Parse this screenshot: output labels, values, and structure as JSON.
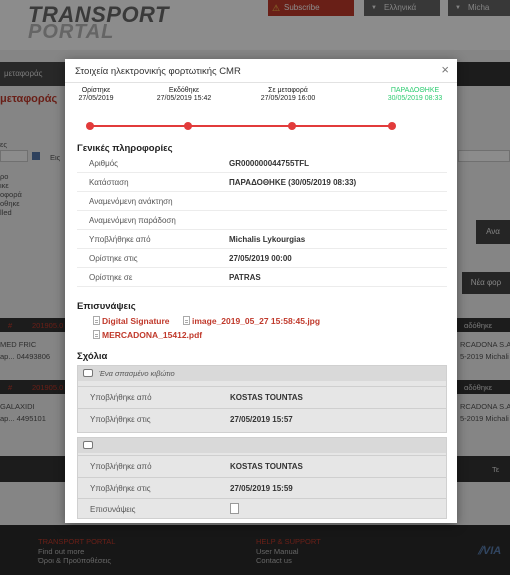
{
  "background": {
    "logo_line1": "TRANSPORT",
    "logo_line2": "PORTAL",
    "subscribe_label": "Subscribe",
    "language_label": "Ελληνικά",
    "user_label": "Micha",
    "nav_item": "μεταφοράς",
    "page_title": "μεταφοράς",
    "filter_lines": [
      "ες",
      "Εις",
      "ρο",
      "ικε",
      "οφορά",
      "οθηκε",
      "lled"
    ],
    "button_right": "Ανα",
    "button_new": "Νέα φορ",
    "row1": {
      "hash": "#",
      "id": "201905.0",
      "c1": "MED FRIC",
      "c2": "ap... 04493806",
      "d": "αδόθηκε",
      "e": "RCADONA S.A",
      "f": "5-2019 Michali"
    },
    "row2": {
      "hash": "#",
      "id": "201905.0",
      "c1": "GALAXIDI",
      "c2": "ap... 4495101",
      "d": "αδόθηκε",
      "e": "RCADONA S.A",
      "f": "5-2019 Michali"
    },
    "pager": "Τε",
    "footer": {
      "col1_title": "TRANSPORT PORTAL",
      "col1_link1": "Find out more",
      "col1_link2": "Όροι & Προϋποθέσεις",
      "col2_title": "HELP & SUPPORT",
      "col2_link1": "User Manual",
      "col2_link2": "Contact us",
      "brand": "VIA"
    }
  },
  "modal": {
    "title": "Στοιχεία ηλεκτρονικής φορτωτικής CMR",
    "close": "×",
    "timeline": [
      {
        "label": "Ορίστηκε",
        "date": "27/05/2019"
      },
      {
        "label": "Εκδόθηκε",
        "date": "27/05/2019 15:42"
      },
      {
        "label": "Σε μεταφορά",
        "date": "27/05/2019 16:00"
      },
      {
        "label": "ΠΑΡΑΔΟΘΗΚΕ",
        "date": "30/05/2019 08:33"
      }
    ],
    "general_title": "Γενικές πληροφορίες",
    "info": [
      {
        "label": "Αριθμός",
        "value": "GR000000044755TFL"
      },
      {
        "label": "Κατάσταση",
        "value": "ΠΑΡΑΔΟΘΗΚΕ (30/05/2019 08:33)"
      },
      {
        "label": "Αναμενόμενη ανάκτηση",
        "value": ""
      },
      {
        "label": "Αναμενόμενη παράδοση",
        "value": ""
      },
      {
        "label": "Υποβλήθηκε από",
        "value": "Michalis Lykourgias"
      },
      {
        "label": "Ορίστηκε στις",
        "value": "27/05/2019 00:00"
      },
      {
        "label": "Ορίστηκε σε",
        "value": "PATRAS"
      }
    ],
    "attachments_title": "Επισυνάψεις",
    "attachments": [
      "Digital Signature",
      "image_2019_05_27 15:58:45.jpg",
      "MERCADONA_15412.pdf"
    ],
    "comments_title": "Σχόλια",
    "comments": [
      {
        "text": "Ένα σπασμένο κιβώτιο",
        "submitted_by_label": "Υποβλήθηκε από",
        "submitted_by": "KOSTAS TOUNTAS",
        "submitted_at_label": "Υποβλήθηκε στις",
        "submitted_at": "27/05/2019 15:57"
      },
      {
        "text": "",
        "submitted_by_label": "Υποβλήθηκε από",
        "submitted_by": "KOSTAS TOUNTAS",
        "submitted_at_label": "Υποβλήθηκε στις",
        "submitted_at": "27/05/2019 15:59",
        "attachments_label": "Επισυνάψεις"
      }
    ]
  },
  "colors": {
    "accent_red": "#e23b3b",
    "delivered_green": "#2ecc71",
    "nav_dark": "#333333"
  }
}
